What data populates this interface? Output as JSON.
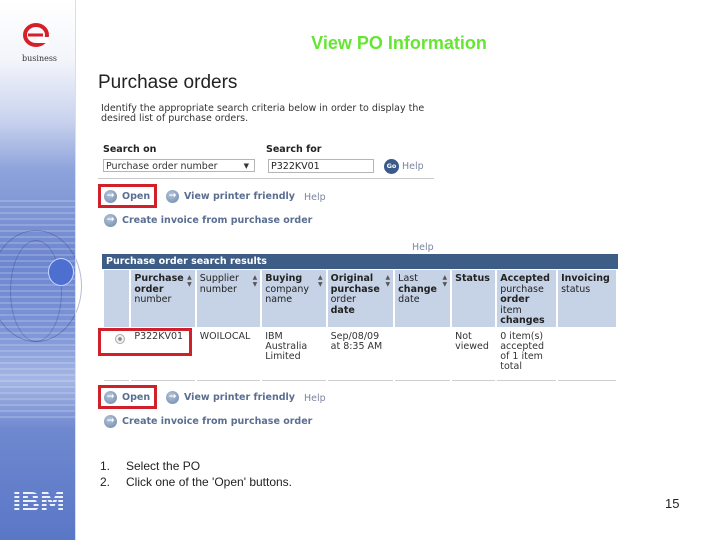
{
  "slide": {
    "title": "View PO Information",
    "page_number": "15",
    "brand_top": "business",
    "brand_bottom": "IBM",
    "steps": [
      {
        "num": "1.",
        "text": "Select the PO"
      },
      {
        "num": "2.",
        "text": "Click one of the 'Open' buttons."
      }
    ]
  },
  "screen": {
    "heading": "Purchase orders",
    "intro": "Identify the appropriate search criteria below in order to display the desired list of purchase orders.",
    "search": {
      "search_on_label": "Search on",
      "search_on_value": "Purchase order number",
      "search_for_label": "Search for",
      "search_for_value": "P322KV01",
      "go_label": "Go",
      "help_label": "Help"
    },
    "actions_top": {
      "open": "Open",
      "view_printer_friendly": "View printer friendly",
      "help": "Help",
      "create_invoice": "Create invoice from purchase order"
    },
    "results": {
      "help_label": "Help",
      "title": "Purchase order search results",
      "columns": [
        {
          "bold": "Purchase order",
          "rest": "number",
          "sortable": true
        },
        {
          "bold": "",
          "rest": "Supplier number",
          "sortable": true
        },
        {
          "bold": "Buying",
          "rest": "company name",
          "sortable": true
        },
        {
          "bold": "Original purchase order date",
          "rest": "",
          "sortable": true
        },
        {
          "bold": "change",
          "pre": "Last",
          "rest": "date",
          "sortable": true
        },
        {
          "bold": "Status",
          "rest": "",
          "sortable": false
        },
        {
          "bold": "Accepted",
          "rest": "purchase order item changes",
          "sortable": false
        },
        {
          "bold": "Invoicing",
          "rest": "status",
          "sortable": false
        }
      ],
      "header_text": [
        [
          "Purchase",
          "order",
          "number"
        ],
        [
          "Supplier",
          "number"
        ],
        [
          "Buying",
          "company",
          "name"
        ],
        [
          "Original",
          "purchase",
          "order",
          "date"
        ],
        [
          "Last",
          "change",
          "date"
        ],
        [
          "Status"
        ],
        [
          "Accepted",
          "purchase",
          "order",
          "item",
          "changes"
        ],
        [
          "Invoicing",
          "status"
        ]
      ],
      "rows": [
        {
          "selected": true,
          "po_number": "P322KV01",
          "supplier_number": "WOILOCAL",
          "buying_company": [
            "IBM",
            "Australia",
            "Limited"
          ],
          "original_date": [
            "Sep/08/09",
            "at 8:35 AM"
          ],
          "last_change_date": "",
          "status": [
            "Not",
            "viewed"
          ],
          "accepted_changes": [
            "0 item(s)",
            "accepted",
            "of 1 item",
            "total"
          ],
          "invoicing_status": ""
        }
      ]
    },
    "actions_bottom": {
      "open": "Open",
      "view_printer_friendly": "View printer friendly",
      "help": "Help",
      "create_invoice": "Create invoice from purchase order"
    }
  },
  "colors": {
    "title_green": "#66e632",
    "highlight_red": "#d0202a",
    "results_bar": "#3d5d86",
    "header_cell": "#c6d3e6"
  }
}
